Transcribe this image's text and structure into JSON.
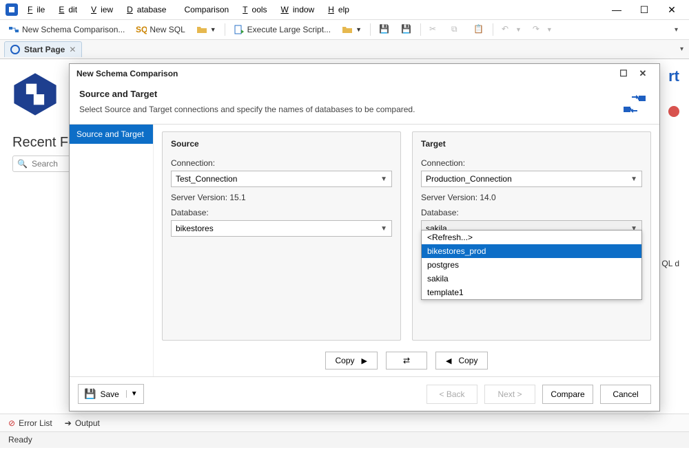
{
  "menu": {
    "file": "File",
    "edit": "Edit",
    "view": "View",
    "database": "Database",
    "comparison": "Comparison",
    "tools": "Tools",
    "window": "Window",
    "help": "Help"
  },
  "toolbar": {
    "new_schema": "New Schema Comparison...",
    "new_sql": "New SQL",
    "execute_large": "Execute Large Script..."
  },
  "tab": {
    "label": "Start Page"
  },
  "start_page": {
    "recent": "Recent Files",
    "search_placeholder": "Search",
    "brand_suffix": "rt",
    "truncated": "QL d"
  },
  "bottom_tabs": {
    "error": "Error List",
    "output": "Output"
  },
  "status": "Ready",
  "dialog": {
    "title": "New Schema Comparison",
    "heading": "Source and Target",
    "description": "Select Source and Target connections and specify the names of databases to be compared.",
    "sidebar_step": "Source and Target",
    "source": {
      "title": "Source",
      "connection_label": "Connection:",
      "connection_value": "Test_Connection",
      "server_version": "Server Version: 15.1",
      "database_label": "Database:",
      "database_value": "bikestores"
    },
    "target": {
      "title": "Target",
      "connection_label": "Connection:",
      "connection_value": "Production_Connection",
      "server_version": "Server Version: 14.0",
      "database_label": "Database:",
      "database_value": "sakila",
      "options": [
        "<Refresh...>",
        "bikestores_prod",
        "postgres",
        "sakila",
        "template1"
      ],
      "selected_index": 1
    },
    "copy_right": "Copy",
    "copy_left": "Copy",
    "save": "Save",
    "back": "< Back",
    "next": "Next >",
    "compare": "Compare",
    "cancel": "Cancel"
  }
}
